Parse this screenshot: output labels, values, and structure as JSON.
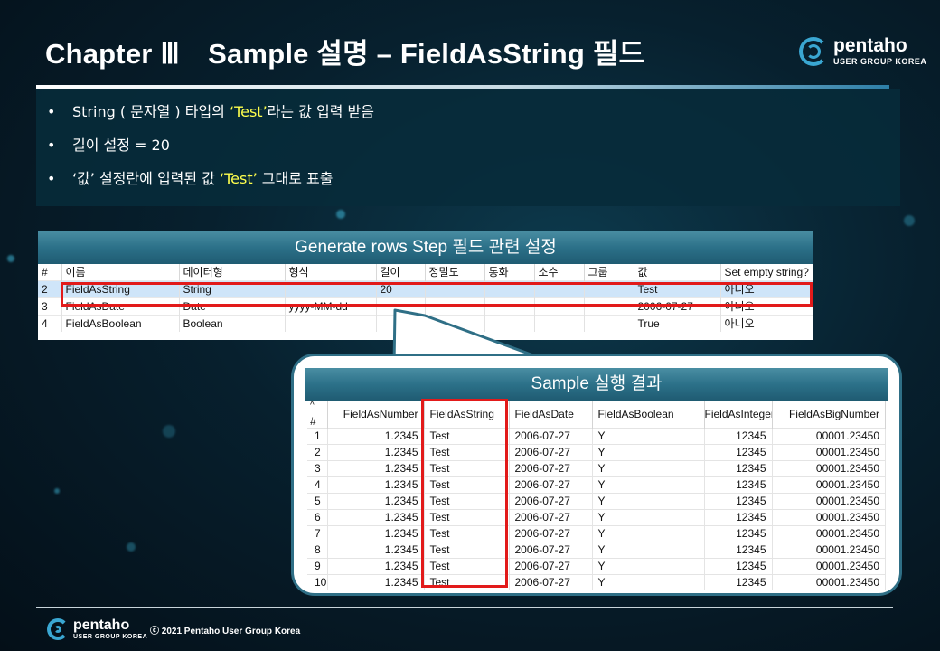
{
  "slide": {
    "title": "Chapter Ⅲ　Sample 설명 – FieldAsString 필드",
    "copyright": "ⓒ 2021 Pentaho User Group Korea"
  },
  "logo": {
    "name": "pentaho",
    "subtitle": "USER GROUP KOREA",
    "icon": "pentaho-swirl-icon",
    "accent_color": "#3aa7d2"
  },
  "bullets": [
    {
      "before": "String ( 문자열 ) 타입의 ",
      "highlight": "‘Test’",
      "after": "라는 값 입력 받음"
    },
    {
      "before": "길이 설정 = 20",
      "highlight": "",
      "after": ""
    },
    {
      "before": "‘값’ 설정란에 입력된 값 ",
      "highlight": "‘Test’",
      "after": " 그대로 표출"
    }
  ],
  "highlight_color": "#ffff4d",
  "generate_rows": {
    "header": "Generate rows Step 필드 관련 설정",
    "sort_marker": "^",
    "columns": [
      "#",
      "이름",
      "데이터형",
      "형식",
      "길이",
      "정밀도",
      "통화",
      "소수",
      "그룹",
      "값",
      "Set empty string?"
    ],
    "rows": [
      [
        "2",
        "FieldAsString",
        "String",
        "",
        "20",
        "",
        "",
        "",
        "",
        "Test",
        "아니오"
      ],
      [
        "3",
        "FieldAsDate",
        "Date",
        "yyyy-MM-dd",
        "",
        "",
        "",
        "",
        "",
        "2006-07-27",
        "아니오"
      ],
      [
        "4",
        "FieldAsBoolean",
        "Boolean",
        "",
        "",
        "",
        "",
        "",
        "",
        "True",
        "아니오"
      ]
    ],
    "selected_row_index": 0
  },
  "result": {
    "header": "Sample 실행 결과",
    "sort_marker": "^",
    "columns": [
      "#",
      "FieldAsNumber",
      "FieldAsString",
      "FieldAsDate",
      "FieldAsBoolean",
      "FieldAsInteger",
      "FieldAsBigNumber"
    ],
    "rows": [
      [
        "1",
        "1.2345",
        "Test",
        "2006-07-27",
        "Y",
        "12345",
        "00001.23450"
      ],
      [
        "2",
        "1.2345",
        "Test",
        "2006-07-27",
        "Y",
        "12345",
        "00001.23450"
      ],
      [
        "3",
        "1.2345",
        "Test",
        "2006-07-27",
        "Y",
        "12345",
        "00001.23450"
      ],
      [
        "4",
        "1.2345",
        "Test",
        "2006-07-27",
        "Y",
        "12345",
        "00001.23450"
      ],
      [
        "5",
        "1.2345",
        "Test",
        "2006-07-27",
        "Y",
        "12345",
        "00001.23450"
      ],
      [
        "6",
        "1.2345",
        "Test",
        "2006-07-27",
        "Y",
        "12345",
        "00001.23450"
      ],
      [
        "7",
        "1.2345",
        "Test",
        "2006-07-27",
        "Y",
        "12345",
        "00001.23450"
      ],
      [
        "8",
        "1.2345",
        "Test",
        "2006-07-27",
        "Y",
        "12345",
        "00001.23450"
      ],
      [
        "9",
        "1.2345",
        "Test",
        "2006-07-27",
        "Y",
        "12345",
        "00001.23450"
      ],
      [
        "10",
        "1.2345",
        "Test",
        "2006-07-27",
        "Y",
        "12345",
        "00001.23450"
      ]
    ]
  },
  "colors": {
    "highlight_box": "#e21a1a",
    "panel_header": "#2c7189",
    "selected_row": "#cfe5f9"
  }
}
